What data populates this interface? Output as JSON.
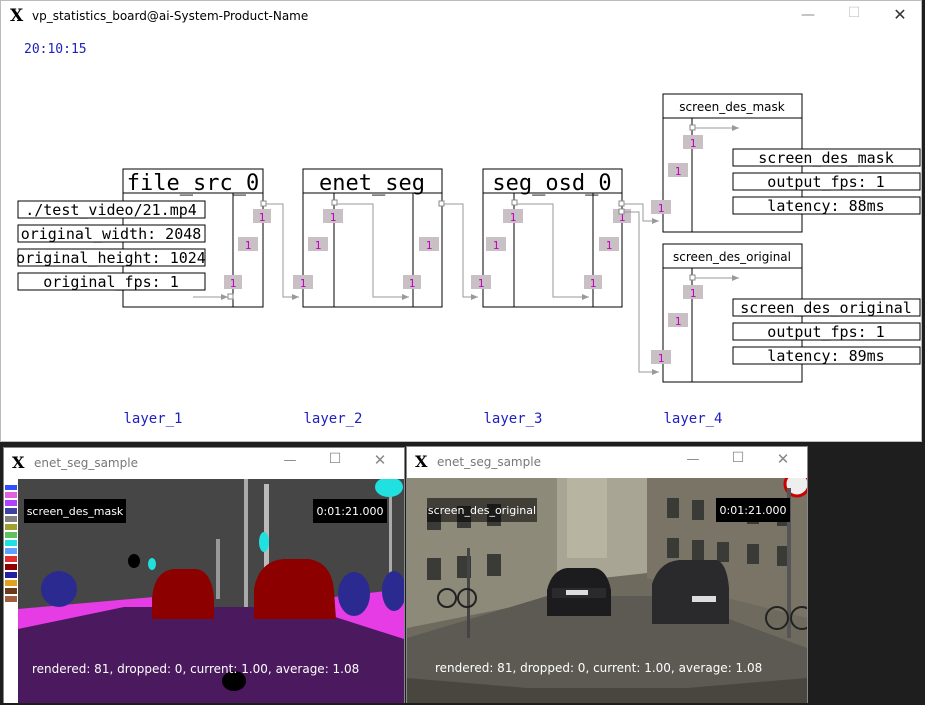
{
  "main_window": {
    "title": "vp_statistics_board@ai-System-Product-Name",
    "clock": "20:10:15",
    "layers": [
      "layer_1",
      "layer_2",
      "layer_3",
      "layer_4"
    ],
    "nodes": {
      "file_src": {
        "name": "file_src_0",
        "props": [
          "./test_video/21.mp4",
          "original_width: 2048",
          "original_height: 1024",
          "original_fps: 1"
        ],
        "badges": [
          "1",
          "1",
          "1"
        ]
      },
      "enet_seg": {
        "name": "enet_seg",
        "badges": [
          "1",
          "1",
          "1",
          "1"
        ]
      },
      "seg_osd": {
        "name": "seg_osd_0",
        "badges": [
          "1",
          "1",
          "1",
          "1"
        ]
      },
      "screen_mask": {
        "name": "screen_des_mask",
        "props": [
          "screen_des_mask",
          "output_fps: 1",
          "latency: 88ms"
        ],
        "badges": [
          "1",
          "1",
          "1"
        ]
      },
      "screen_orig": {
        "name": "screen_des_original",
        "props": [
          "screen_des_original",
          "output_fps: 1",
          "latency: 89ms"
        ],
        "badges": [
          "1",
          "1",
          "1"
        ]
      }
    }
  },
  "sample_windows": [
    {
      "title": "enet_seg_sample",
      "label": "screen_des_mask",
      "timestamp": "0:01:21.000",
      "stats": "rendered: 81, dropped: 0, current: 1.00, average: 1.08"
    },
    {
      "title": "enet_seg_sample",
      "label": "screen_des_original",
      "timestamp": "0:01:21.000",
      "stats": "rendered: 81, dropped: 0, current: 1.00, average: 1.08"
    }
  ],
  "colors": {
    "clock_blue": "#2020c0",
    "layer_blue": "#2020c0",
    "badge_bg": "#c8c0c4",
    "badge_text": "#c000c0",
    "road_purple": "#4b1a5e",
    "sidewalk_magenta": "#e63ce6",
    "car_red": "#8c0000",
    "sky_gray": "#464646"
  },
  "icons": {
    "app": "x-logo-icon",
    "minimize": "minimize-icon",
    "maximize": "maximize-icon",
    "close": "close-icon"
  }
}
